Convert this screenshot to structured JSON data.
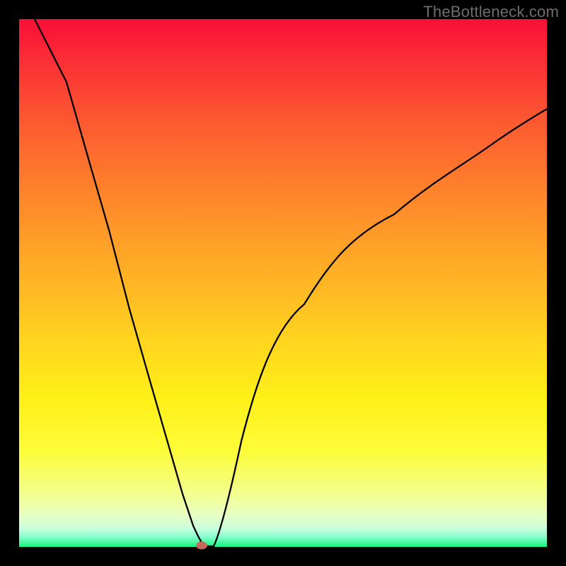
{
  "watermark": "TheBottleneck.com",
  "chart_data": {
    "type": "line",
    "title": "",
    "xlabel": "",
    "ylabel": "",
    "xlim": [
      0,
      100
    ],
    "ylim": [
      0,
      100
    ],
    "grid": false,
    "series": [
      {
        "name": "curve-left",
        "x": [
          3,
          6,
          10,
          14,
          18,
          22,
          26,
          28,
          30,
          31,
          32,
          33
        ],
        "values": [
          100,
          88,
          74,
          60,
          45,
          31,
          17,
          10,
          4,
          2,
          0,
          0
        ]
      },
      {
        "name": "curve-right",
        "x": [
          33,
          34,
          36,
          38,
          41,
          45,
          50,
          56,
          63,
          71,
          80,
          90,
          100
        ],
        "values": [
          0,
          2,
          8,
          15,
          24,
          35,
          46,
          55,
          63,
          70,
          76,
          80,
          83
        ]
      }
    ],
    "marker": {
      "x": 34,
      "y": 0,
      "color": "#c7685c"
    },
    "gradient_stops": [
      {
        "pos": 0,
        "color": "#fa0f38"
      },
      {
        "pos": 0.33,
        "color": "#ff842b"
      },
      {
        "pos": 0.6,
        "color": "#ffd21f"
      },
      {
        "pos": 0.82,
        "color": "#fdfc3a"
      },
      {
        "pos": 0.96,
        "color": "#c9ffdd"
      },
      {
        "pos": 1.0,
        "color": "#13f67f"
      }
    ]
  }
}
